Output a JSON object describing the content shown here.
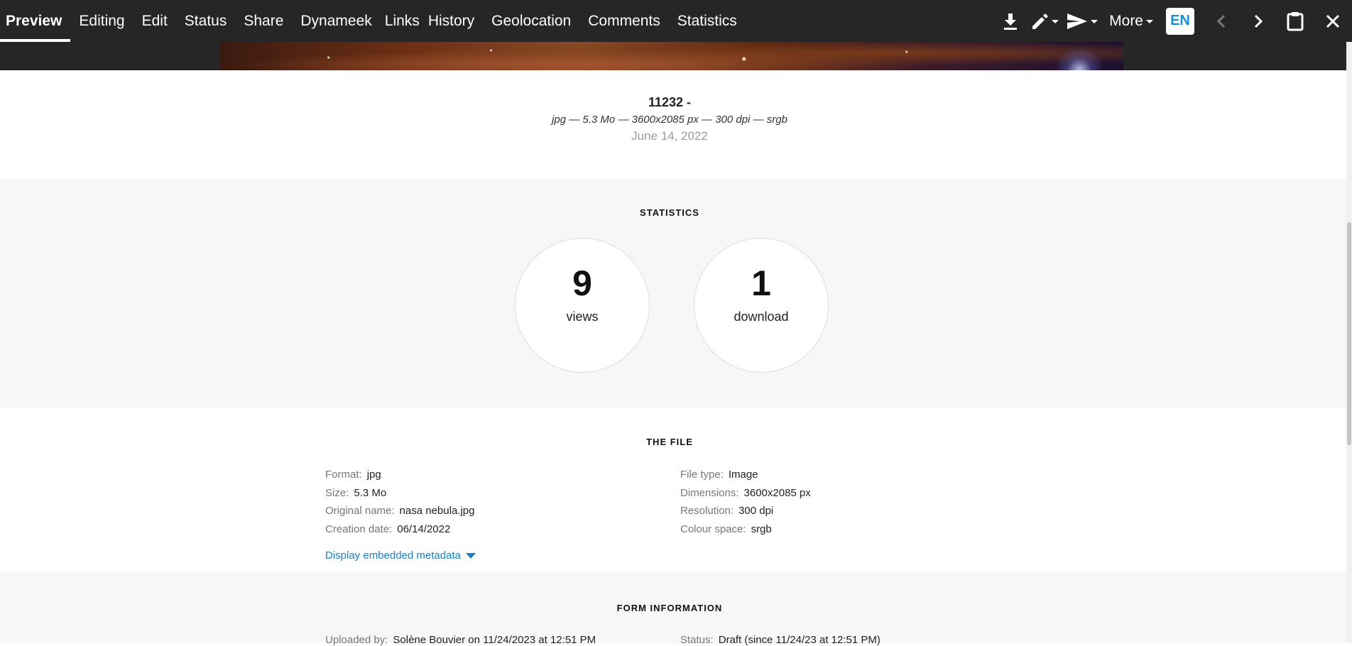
{
  "nav": {
    "tabs": [
      "Preview",
      "Editing",
      "Edit",
      "Status",
      "Share",
      "Dynameek",
      "Links",
      "History",
      "Geolocation",
      "Comments",
      "Statistics"
    ],
    "active_tab": "Preview",
    "more_label": "More",
    "language": "EN"
  },
  "asset": {
    "title": "11232 -",
    "meta": "jpg — 5.3 Mo — 3600x2085 px — 300 dpi — srgb",
    "date": "June 14, 2022"
  },
  "statistics": {
    "heading": "STATISTICS",
    "views_count": "9",
    "views_label": "views",
    "downloads_count": "1",
    "downloads_label": "download"
  },
  "file": {
    "heading": "THE FILE",
    "left": [
      {
        "key": "Format:",
        "value": "jpg"
      },
      {
        "key": "Size:",
        "value": "5.3 Mo"
      },
      {
        "key": "Original name:",
        "value": "nasa nebula.jpg"
      },
      {
        "key": "Creation date:",
        "value": "06/14/2022"
      }
    ],
    "right": [
      {
        "key": "File type:",
        "value": "Image"
      },
      {
        "key": "Dimensions:",
        "value": "3600x2085 px"
      },
      {
        "key": "Resolution:",
        "value": "300 dpi"
      },
      {
        "key": "Colour space:",
        "value": "srgb"
      }
    ],
    "metadata_link": "Display embedded metadata"
  },
  "form": {
    "heading": "FORM INFORMATION",
    "uploaded_key": "Uploaded by:",
    "uploaded_value": "Solène Bouvier on 11/24/2023 at 12:51 PM",
    "status_key": "Status:",
    "status_value": "Draft (since 11/24/23 at 12:51 PM)"
  }
}
